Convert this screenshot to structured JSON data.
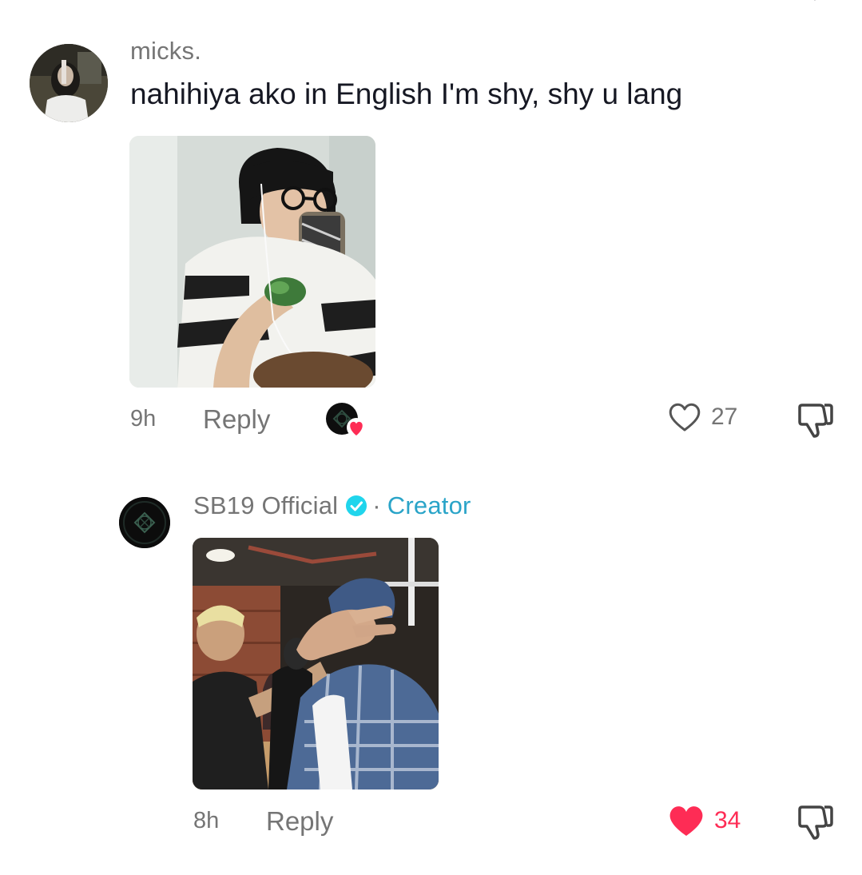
{
  "comment": {
    "username": "micks.",
    "text": "nahihiya ako in English I'm shy, shy u lang",
    "time": "9h",
    "reply_label": "Reply",
    "like_count": "27",
    "liked": false
  },
  "reply": {
    "username": "SB19 Official",
    "separator": "·",
    "badge_label": "Creator",
    "time": "8h",
    "reply_label": "Reply",
    "like_count": "34",
    "liked": true
  },
  "colors": {
    "username": "#757575",
    "text": "#161823",
    "creator_accent": "#2aa4c8",
    "like_active": "#fe2c55",
    "meta": "#757575"
  },
  "icons": {
    "close": "close-icon",
    "verified": "verified-badge-icon",
    "heart_outline": "heart-outline-icon",
    "heart_filled": "heart-filled-icon",
    "dislike": "thumbs-down-icon",
    "creator_liked": "creator-liked-avatar-icon"
  }
}
